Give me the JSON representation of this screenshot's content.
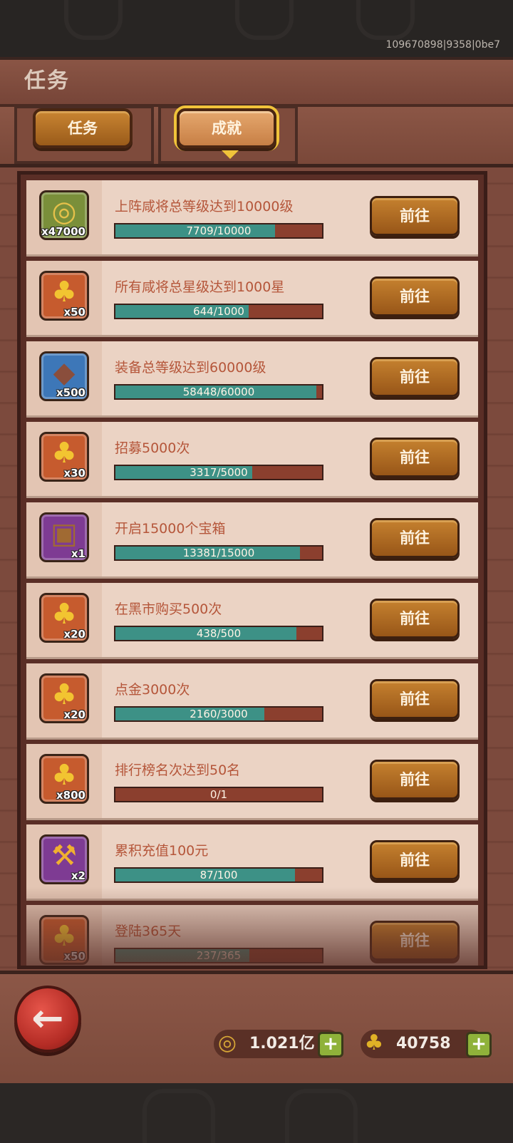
{
  "build_id": "109670898|9358|0be7",
  "page_title": "任务",
  "tabs": [
    {
      "label": "任务",
      "active": false
    },
    {
      "label": "成就",
      "active": true
    }
  ],
  "go_label": "前往",
  "tasks": [
    {
      "title": "上阵咸将总等级达到10000级",
      "progress_text": "7709/10000",
      "progress": 0.7709,
      "reward_icon": "coin-icon",
      "reward_qty": "x47000",
      "frame": "green"
    },
    {
      "title": "所有咸将总星级达到1000星",
      "progress_text": "644/1000",
      "progress": 0.644,
      "reward_icon": "gold-ticket-icon",
      "reward_qty": "x50",
      "frame": "orange"
    },
    {
      "title": "装备总等级达到60000级",
      "progress_text": "58448/60000",
      "progress": 0.974,
      "reward_icon": "stone-icon",
      "reward_qty": "x500",
      "frame": "blue"
    },
    {
      "title": "招募5000次",
      "progress_text": "3317/5000",
      "progress": 0.6634,
      "reward_icon": "gold-ticket-icon",
      "reward_qty": "x30",
      "frame": "orange"
    },
    {
      "title": "开启15000个宝箱",
      "progress_text": "13381/15000",
      "progress": 0.892,
      "reward_icon": "treasure-chest-icon",
      "reward_qty": "x1",
      "frame": "purple"
    },
    {
      "title": "在黑市购买500次",
      "progress_text": "438/500",
      "progress": 0.876,
      "reward_icon": "gold-ticket-icon",
      "reward_qty": "x20",
      "frame": "orange"
    },
    {
      "title": "点金3000次",
      "progress_text": "2160/3000",
      "progress": 0.72,
      "reward_icon": "gold-ticket-icon",
      "reward_qty": "x20",
      "frame": "orange"
    },
    {
      "title": "排行榜名次达到50名",
      "progress_text": "0/1",
      "progress": 0.0,
      "reward_icon": "gold-ticket-icon",
      "reward_qty": "x800",
      "frame": "orange"
    },
    {
      "title": "累积充值100元",
      "progress_text": "87/100",
      "progress": 0.87,
      "reward_icon": "golden-club-icon",
      "reward_qty": "x2",
      "frame": "purple"
    },
    {
      "title": "登陆365天",
      "progress_text": "237/365",
      "progress": 0.649,
      "reward_icon": "gold-ticket-icon",
      "reward_qty": "x50",
      "frame": "orange"
    }
  ],
  "resources": {
    "coin": {
      "value": "1.021亿",
      "icon": "coin-icon"
    },
    "ticket": {
      "value": "40758",
      "icon": "gold-ticket-icon"
    }
  },
  "icons": {
    "back": "back-arrow-icon",
    "plus": "plus-icon"
  },
  "colors": {
    "progress_fill": "#3d9186",
    "progress_track": "#8b3f2e",
    "title_text": "#b5563a",
    "button": "#c5812f"
  }
}
